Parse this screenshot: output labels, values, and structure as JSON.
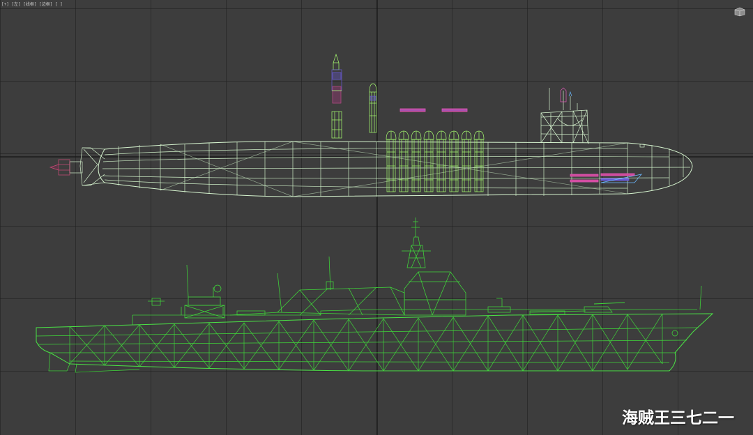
{
  "viewport": {
    "label": "[+] [左] [线框] [边框] [ ]",
    "view_name": "left",
    "shading": "wireframe"
  },
  "icons": {
    "viewcube": "viewcube-icon",
    "viewport_menu": "viewport-menu-icon"
  },
  "scene": {
    "models": [
      "submarine-wireframe",
      "destroyer-wireframe"
    ],
    "colors": {
      "viewport_bg": "#3d3d3d",
      "grid_line": "#2a2a2a",
      "axis_line": "#141414",
      "hull_wire": "#c8f2c0",
      "ship_wire": "#3fd83a",
      "missile_wire": "#9cff6a",
      "torpedo_pink": "#e05ab8",
      "torpedo_blue": "#6a5ad8",
      "tail_red": "#d04a7a"
    },
    "missile_tube_count": 8
  },
  "watermark": {
    "text": "海贼王三七二一"
  }
}
